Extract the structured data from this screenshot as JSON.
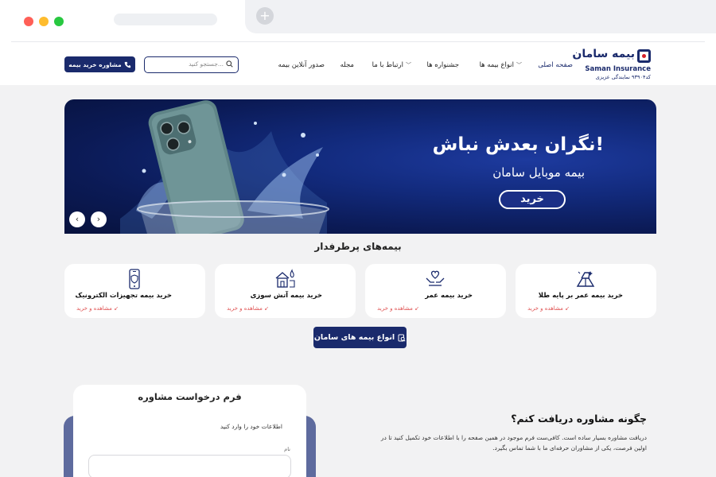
{
  "colors": {
    "brand": "#1a2a6c",
    "accent_red": "#d4202a",
    "link_red": "#e05555",
    "page_bg": "#f2f2f3",
    "traffic_red": "#ff5f57",
    "traffic_yellow": "#febc2e",
    "traffic_green": "#28c840"
  },
  "browser": {
    "new_tab_label": "+"
  },
  "logo": {
    "fa": "بیمه سامان",
    "en": "Saman Insurance",
    "code": "کد۹۳۹۰۴ نمایندگی عزیزی"
  },
  "nav": {
    "items": [
      {
        "label": "صفحه اصلی",
        "dropdown": false
      },
      {
        "label": "انواع بیمه ها",
        "dropdown": true
      },
      {
        "label": "جشنواره ها",
        "dropdown": false
      },
      {
        "label": "ارتباط با ما",
        "dropdown": true
      },
      {
        "label": "مجله",
        "dropdown": false
      },
      {
        "label": "صدور آنلاین بیمه",
        "dropdown": false
      }
    ],
    "chevron": "﹀"
  },
  "search": {
    "placeholder": "جستجو کنید..."
  },
  "consult_button": {
    "label": "مشاوره خرید بیمه",
    "icon": "phone-icon"
  },
  "banner": {
    "title": "نگران بعدش نباش!",
    "subtitle": "بیمه موبایل سامان",
    "buy_label": "خرید",
    "prev": "‹",
    "next": "›"
  },
  "popular": {
    "title": "بیمه‌های پرطرفدار",
    "cards": [
      {
        "title": "خرید بیمه عمر بر پایه طلا",
        "link": "مشاهده و خرید ↙",
        "icon": "gold-bars-icon"
      },
      {
        "title": "خرید بیمه عمر",
        "link": "مشاهده و خرید ↙",
        "icon": "hands-heart-icon"
      },
      {
        "title": "خرید بیمه آتش سوزی",
        "link": "مشاهده و خرید ↙",
        "icon": "house-fire-icon"
      },
      {
        "title": "خرید بیمه تجهیزات الکترونیک",
        "link": "مشاهده و خرید ↙",
        "icon": "phone-shield-icon"
      }
    ]
  },
  "types_button": {
    "label": "انواع بیمه های سامان",
    "icon": "search-doc-icon"
  },
  "form": {
    "title": "فرم درخواست مشاوره",
    "info": "اطلاعات خود را وارد کنید",
    "name_label": "نام"
  },
  "how": {
    "title": "چگونه مشاوره دریافت کنم؟",
    "text": "دریافت مشاوره بسیار ساده است. کافی‌ست فرم موجود در همین صفحه را با اطلاعات خود تکمیل کنید تا در اولین فرصت، یکی از مشاوران حرفه‌ای ما با شما تماس بگیرد."
  }
}
